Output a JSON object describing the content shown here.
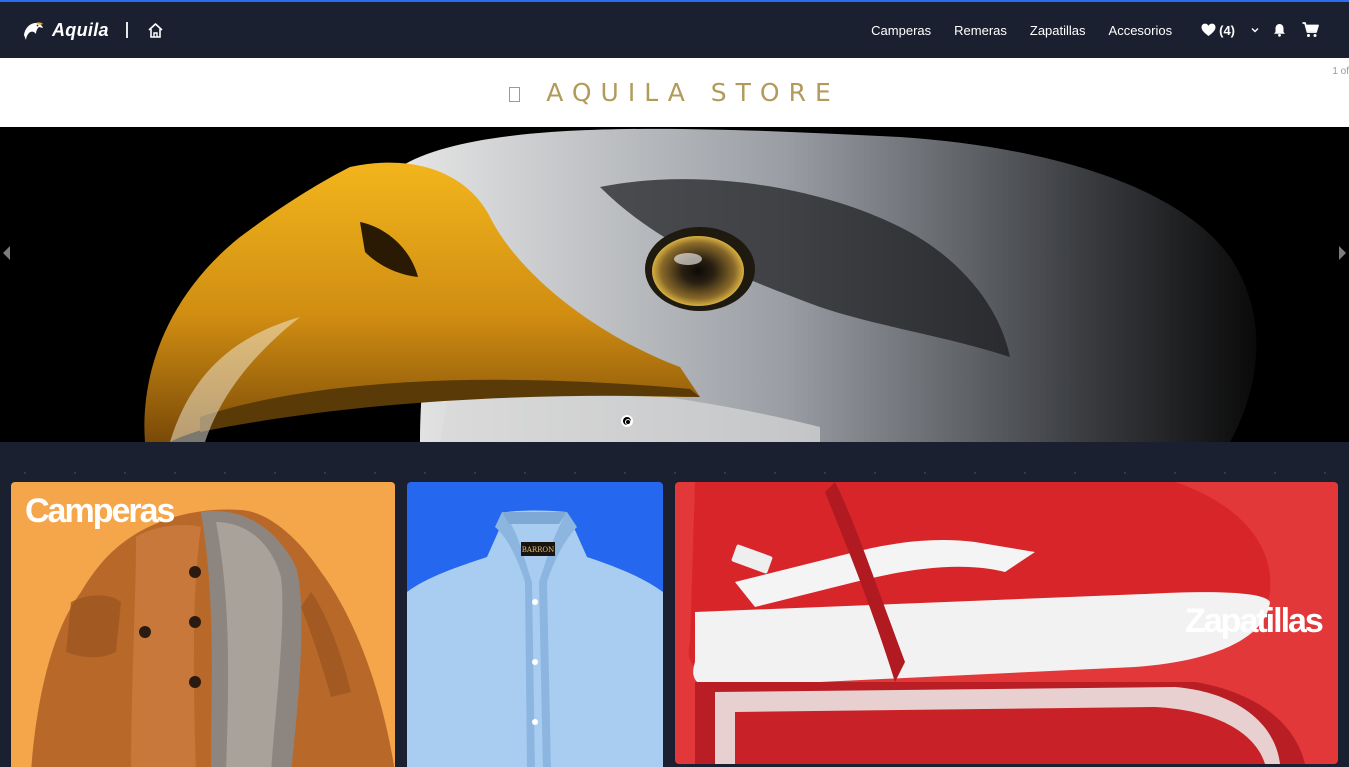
{
  "navbar": {
    "brand_name": "Aquila",
    "links": [
      "Camperas",
      "Remeras",
      "Zapatillas",
      "Accesorios"
    ],
    "favorites_count": "(4)"
  },
  "store": {
    "title": "AQUILA STORE",
    "slide_counter": "1 of"
  },
  "hero": {
    "total_slides": 1,
    "active_slide": 1
  },
  "categories": {
    "jackets": "Camperas",
    "shoes": "Zapatillas",
    "shirt_brand": "BARRON"
  },
  "colors": {
    "navbar_bg": "#1b2030",
    "accent": "#2e6cf2",
    "title_gold": "#b29a5a",
    "jackets_bg": "#f5a64b",
    "shirts_bg": "#2567ef",
    "shoes_bg": "#e2383a"
  }
}
